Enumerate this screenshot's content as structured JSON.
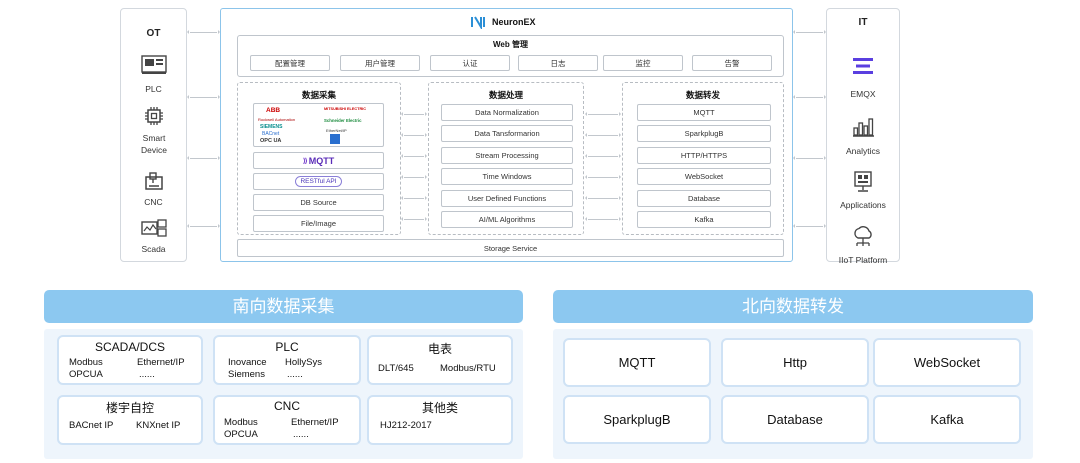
{
  "ot": {
    "title": "OT",
    "items": [
      {
        "label": "PLC",
        "icon": "plc-icon"
      },
      {
        "label": "Smart Device",
        "icon": "chip-icon"
      },
      {
        "label": "CNC",
        "icon": "cnc-icon"
      },
      {
        "label": "Scada",
        "icon": "scada-icon"
      }
    ]
  },
  "it": {
    "title": "IT",
    "items": [
      {
        "label": "EMQX",
        "icon": "emqx-icon"
      },
      {
        "label": "Analytics",
        "icon": "bar-chart-icon"
      },
      {
        "label": "Applications",
        "icon": "applications-icon"
      },
      {
        "label": "IIoT Platform",
        "icon": "cloud-platform-icon"
      }
    ]
  },
  "header": {
    "logo_text": "NeuronEX"
  },
  "web": {
    "title": "Web 管理",
    "items": [
      "配置管理",
      "用户管理",
      "认证",
      "日志",
      "监控",
      "告警"
    ]
  },
  "collect": {
    "title": "数据采集",
    "brands": [
      "ABB",
      "MITSUBISHI ELECTRIC",
      "Rockwell Automation",
      "SIEMENS",
      "Schneider Electric",
      "BACnet",
      "EtherNet/IP",
      "OPC UA"
    ],
    "items": [
      "MQTT",
      "RESTful API",
      "DB Source",
      "File/Image"
    ]
  },
  "process": {
    "title": "数据处理",
    "items": [
      "Data Normalization",
      "Data Tansformarion",
      "Stream Processing",
      "Time Windows",
      "User Defined Functions",
      "AI/ML Algorithms"
    ]
  },
  "forward": {
    "title": "数据转发",
    "items": [
      "MQTT",
      "SparkplugB",
      "HTTP/HTTPS",
      "WebSocket",
      "Database",
      "Kafka"
    ]
  },
  "storage": {
    "label": "Storage Service"
  },
  "south": {
    "title": "南向数据采集",
    "cards": [
      {
        "title": "SCADA/DCS",
        "items": [
          "Modbus",
          "Ethernet/IP",
          "OPCUA",
          "......"
        ]
      },
      {
        "title": "PLC",
        "items": [
          "Inovance",
          "HollySys",
          "Siemens",
          "......"
        ]
      },
      {
        "title": "电表",
        "items": [
          "DLT/645",
          "Modbus/RTU"
        ]
      },
      {
        "title": "楼宇自控",
        "items": [
          "BACnet IP",
          "KNXnet IP"
        ]
      },
      {
        "title": "CNC",
        "items": [
          "Modbus",
          "Ethernet/IP",
          "OPCUA",
          "......"
        ]
      },
      {
        "title": "其他类",
        "items": [
          "HJ212-2017"
        ]
      }
    ]
  },
  "north": {
    "title": "北向数据转发",
    "items": [
      "MQTT",
      "Http",
      "WebSocket",
      "SparkplugB",
      "Database",
      "Kafka"
    ]
  },
  "colors": {
    "accent": "#8cc8f0",
    "border": "#8cc4ea",
    "emqx": "#5a3fe0",
    "card_border": "#cfe2f5"
  }
}
